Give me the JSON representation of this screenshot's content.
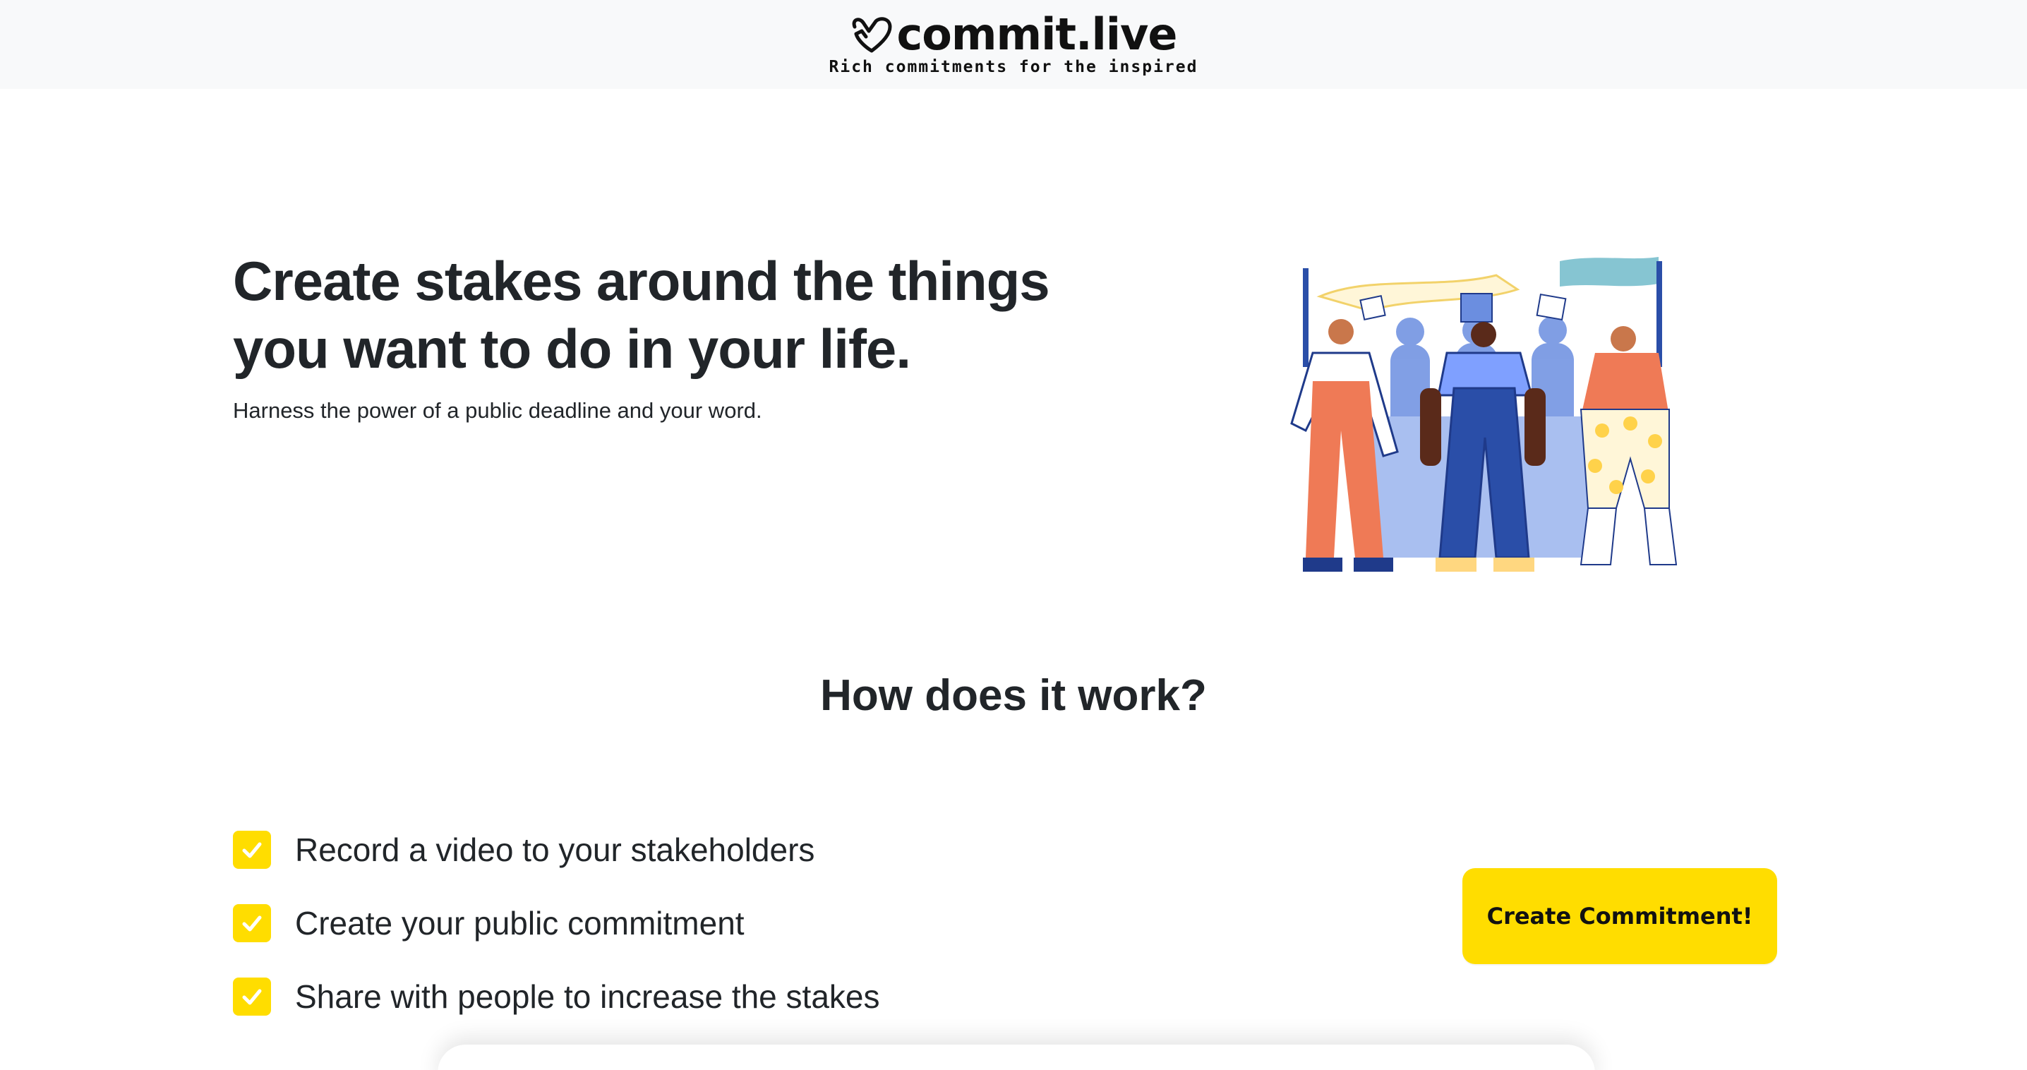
{
  "header": {
    "logo_text": "commit.live",
    "tagline": "Rich commitments for the inspired"
  },
  "hero": {
    "title": "Create stakes around the things you want to do in your life.",
    "subtitle": "Harness the power of a public deadline and your word."
  },
  "how": {
    "title": "How does it work?",
    "steps": [
      {
        "label": "Record a video to your stakeholders"
      },
      {
        "label": "Create your public commitment"
      },
      {
        "label": "Share with people to increase the stakes"
      }
    ]
  },
  "cta": {
    "label": "Create Commitment!"
  },
  "colors": {
    "accent": "#ffdd00",
    "header_bg": "#f8f9fa",
    "text": "#212529"
  },
  "icons": {
    "logo": "heart-hand-icon",
    "step_check": "checkbox-checked-icon"
  }
}
